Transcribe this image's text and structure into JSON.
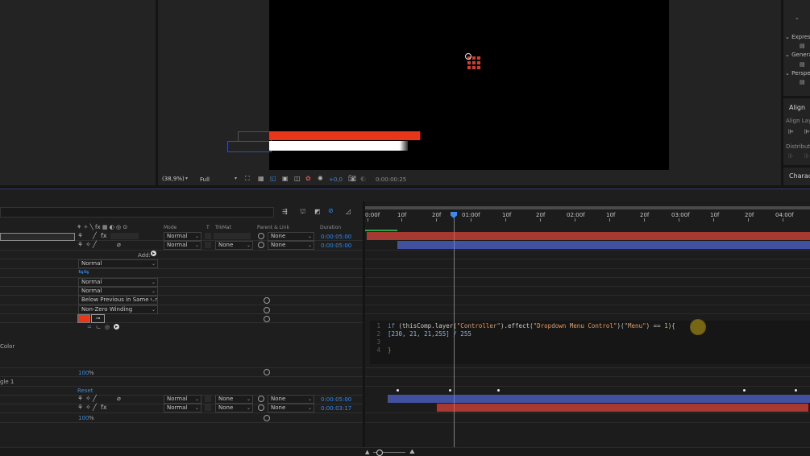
{
  "composition": {
    "zoom": "(38,9%)",
    "resolution": "Full",
    "exposure": "+0,0",
    "timecode": "0:00:00:25"
  },
  "right_panel": {
    "effects_items": [
      "Express",
      "Genera",
      "Perspe"
    ],
    "align_title": "Align",
    "align_layers": "Align Lay",
    "distribute": "Distribut",
    "character": "Characte"
  },
  "timeline": {
    "columns": {
      "mode": "Mode",
      "t": "T",
      "trkmat": "TrkMat",
      "parent": "Parent & Link",
      "duration": "Duration"
    },
    "ruler_labels": [
      "0:00f",
      "10f",
      "20f",
      "01:00f",
      "10f",
      "20f",
      "02:00f",
      "10f",
      "20f",
      "03:00f",
      "10f",
      "20f",
      "04:00f"
    ],
    "layer1": {
      "mode": "Normal",
      "parent": "None",
      "duration": "0:00:05:00"
    },
    "layer2": {
      "mode": "Normal",
      "trkmat": "None",
      "parent": "None",
      "duration": "0:00:05:00"
    },
    "add_label": "Add:",
    "props": {
      "blend_mode": "Normal",
      "normal_a": "Normal",
      "normal_b": "Normal",
      "composite": "Below Previous in Same Gr",
      "fill_rule": "Non-Zero Winding",
      "color_label": "Color",
      "opacity_value": "100",
      "opacity_unit": "%",
      "rect_label": "gle 1",
      "reset": "Reset"
    },
    "layer3": {
      "mode": "Normal",
      "trkmat": "None",
      "parent": "None",
      "duration": "0:00:05:00"
    },
    "layer4": {
      "mode": "Normal",
      "trkmat": "None",
      "parent": "None",
      "duration": "0:00:03:17"
    },
    "bottom_opacity_value": "100",
    "bottom_opacity_unit": "%"
  },
  "expression": {
    "line_numbers": [
      "1",
      "2",
      "3",
      "4"
    ],
    "line1": {
      "kw": "if",
      "pre": " (thisComp.layer(",
      "s1": "\"Controller\"",
      "mid": ").effect(",
      "s2": "\"Dropdown Menu Control\"",
      "mid2": ")(",
      "s3": "\"Menu\"",
      "post": ") == ",
      "num": "1",
      "end": "){"
    },
    "line2": "[230, 21, 21,255] / 255",
    "line4": "}"
  },
  "colors": {
    "accent_blue": "#2d8ceb",
    "shape_red": "#e8361a",
    "bar_red": "#a63a33",
    "bar_blue": "#4250a0",
    "playhead": "#3d8bf0"
  }
}
